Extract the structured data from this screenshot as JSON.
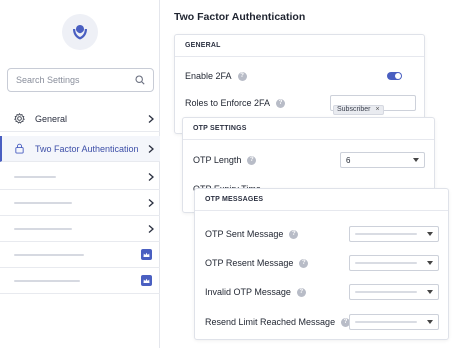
{
  "sidebar": {
    "search_placeholder": "Search Settings",
    "items": [
      {
        "label": "General",
        "icon": "gear-icon"
      },
      {
        "label": "Two Factor Authentication",
        "icon": "lock-icon",
        "active": true
      }
    ]
  },
  "page": {
    "title": "Two Factor Authentication"
  },
  "general": {
    "heading": "GENERAL",
    "enable_label": "Enable 2FA",
    "enable_on": true,
    "roles_label": "Roles to Enforce 2FA",
    "roles": [
      "Subscriber"
    ],
    "remove_glyph": "×"
  },
  "otp": {
    "heading": "OTP SETTINGS",
    "length_label": "OTP Length",
    "length_value": "6",
    "partial_label": "OTP Expiry Time"
  },
  "messages": {
    "heading": "OTP MESSAGES",
    "rows": [
      "OTP Sent Message",
      "OTP Resent Message",
      "Invalid OTP Message",
      "Resend Limit Reached Message"
    ]
  },
  "colors": {
    "accent": "#4a5fc1",
    "crown_badge": "#4a5fc1"
  }
}
